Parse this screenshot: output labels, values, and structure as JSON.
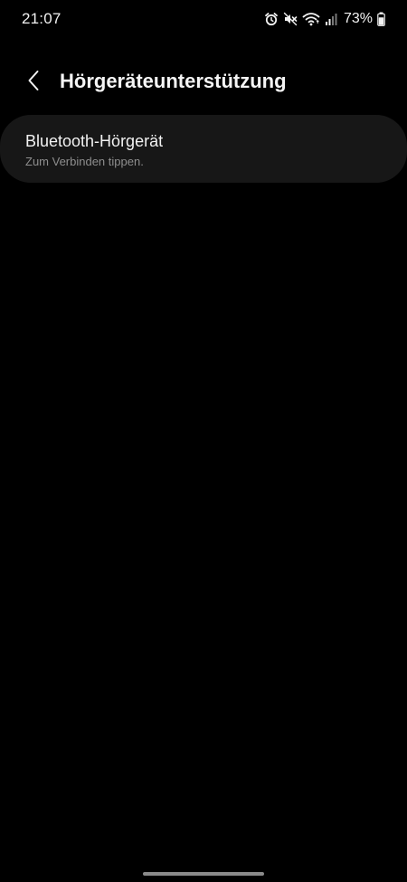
{
  "status_bar": {
    "time": "21:07",
    "battery_percent": "73%",
    "battery_level": 0.73,
    "icons": [
      "alarm-icon",
      "mute-icon",
      "wifi-icon",
      "signal-icon",
      "battery-icon"
    ]
  },
  "app_bar": {
    "back_icon": "chevron-left-icon",
    "title": "Hörgeräteunterstützung"
  },
  "settings": {
    "items": [
      {
        "title": "Bluetooth-Hörgerät",
        "subtitle": "Zum Verbinden tippen."
      }
    ]
  },
  "colors": {
    "background": "#000000",
    "card": "#171717",
    "text_primary": "#f2f2f2",
    "text_secondary": "#8e8e8e",
    "home_indicator": "#8a8a8a"
  }
}
